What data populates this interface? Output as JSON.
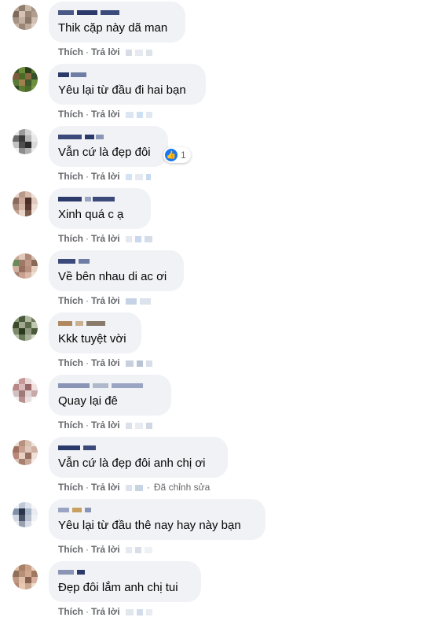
{
  "action_labels": {
    "like": "Thích",
    "reply": "Trả lời",
    "edited": "Đã chỉnh sửa"
  },
  "comments": [
    {
      "author": "Hoa Thuy Tinh",
      "text": "Thik cặp này dã man",
      "time": ""
    },
    {
      "author": "",
      "text": "Yêu lại từ đầu đi hai bạn",
      "time": ""
    },
    {
      "author": "",
      "text": "Vẫn cứ là đẹp đôi",
      "time": "",
      "reaction_count": "1"
    },
    {
      "author": "",
      "text": "Xinh quá c ạ",
      "time": ""
    },
    {
      "author": "",
      "text": "Về bên nhau di ac ơi",
      "time": ""
    },
    {
      "author": "",
      "text": "Kkk tuyệt vời",
      "time": ""
    },
    {
      "author": "",
      "text": "Quay lại đê",
      "time": ""
    },
    {
      "author": "",
      "text": "Vẫn cứ là đẹp đôi anh chị ơi",
      "time": "",
      "edited": true
    },
    {
      "author": "",
      "text": "Yêu lại từ đầu thê nay hay này bạn",
      "time": ""
    },
    {
      "author": "",
      "text": "Đẹp đôi lắm anh chị tui",
      "time": ""
    }
  ],
  "colors": {
    "bubble": "#f0f2f5",
    "action_text": "#65676b",
    "like_blue": "#1877f2",
    "author_blur": "#2b3a6b"
  },
  "icons": {
    "reaction": "like-icon"
  }
}
